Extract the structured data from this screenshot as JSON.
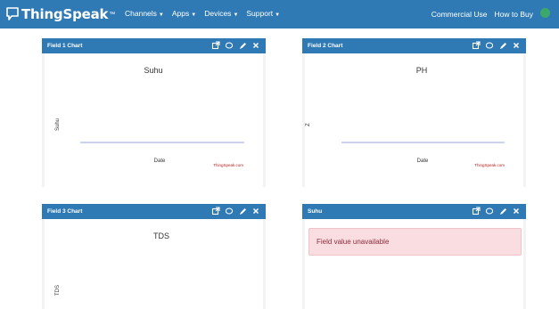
{
  "header": {
    "brand": "ThingSpeak",
    "brand_mark": "™",
    "menu": [
      {
        "label": "Channels"
      },
      {
        "label": "Apps"
      },
      {
        "label": "Devices"
      },
      {
        "label": "Support"
      }
    ],
    "right_links": [
      {
        "label": "Commercial Use"
      },
      {
        "label": "How to Buy"
      }
    ],
    "icons": {
      "logo": "chat-bubble-icon",
      "caret": "caret-down-icon",
      "avatar": "user-avatar-icon"
    }
  },
  "panels": [
    {
      "title": "Field 1 Chart",
      "chart_data": {
        "type": "line",
        "title": "Suhu",
        "xlabel": "Date",
        "ylabel": "Suhu",
        "series": [],
        "credit": "ThingSpeak.com"
      }
    },
    {
      "title": "Field 2 Chart",
      "chart_data": {
        "type": "line",
        "title": "PH",
        "xlabel": "Date",
        "ylabel": "Z",
        "series": [],
        "credit": "ThingSpeak.com"
      }
    },
    {
      "title": "Field 3 Chart",
      "chart_data": {
        "type": "line",
        "title": "TDS",
        "xlabel": "",
        "ylabel": "TDS",
        "series": []
      }
    },
    {
      "title": "Suhu",
      "alert": "Field value unavailable"
    }
  ],
  "panel_tools": [
    "external-link-icon",
    "comment-icon",
    "pencil-icon",
    "close-icon"
  ],
  "colors": {
    "primary": "#2f7ab5",
    "axis_line": "#9aa4d3",
    "credit": "#b22222",
    "alert_bg": "#f9dde1",
    "alert_text": "#8f2d3a"
  }
}
